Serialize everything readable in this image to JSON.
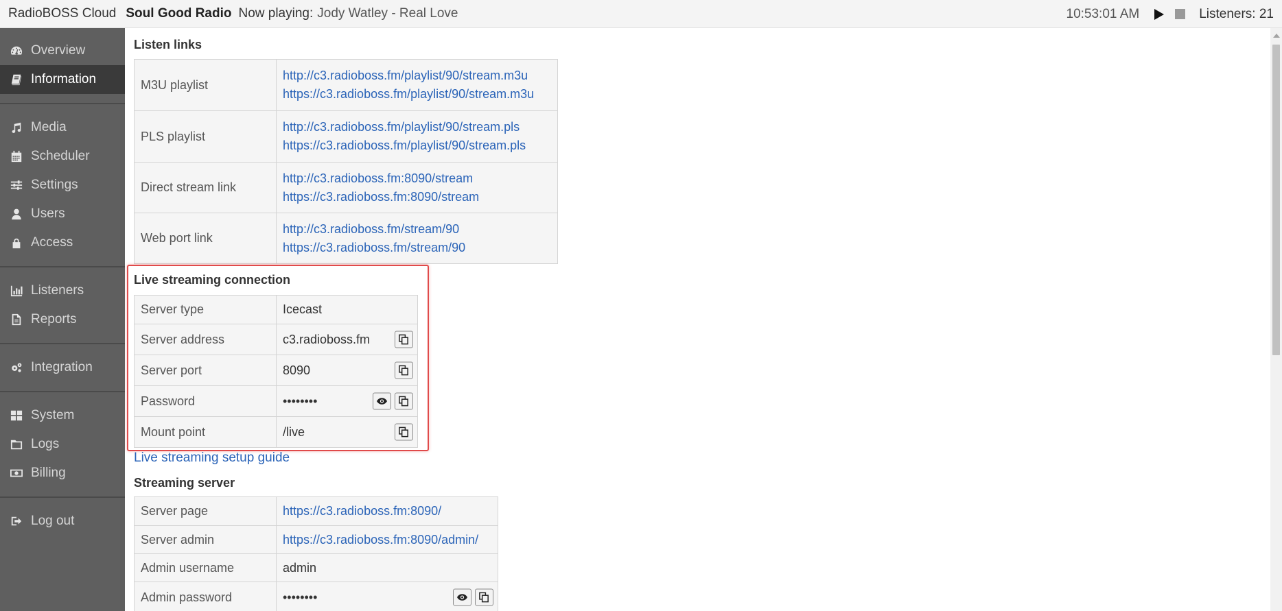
{
  "header": {
    "app_name": "RadioBOSS Cloud",
    "station_name": "Soul Good Radio",
    "now_playing_label": "Now playing:",
    "now_playing_title": "Jody Watley - Real Love",
    "clock": "10:53:01 AM",
    "listeners": "Listeners: 21"
  },
  "sidebar": {
    "items": [
      {
        "label": "Overview",
        "icon": "dashboard-icon"
      },
      {
        "label": "Information",
        "icon": "book-icon",
        "active": true
      },
      {
        "label": "Media",
        "icon": "music-icon"
      },
      {
        "label": "Scheduler",
        "icon": "calendar-icon"
      },
      {
        "label": "Settings",
        "icon": "sliders-icon"
      },
      {
        "label": "Users",
        "icon": "user-icon"
      },
      {
        "label": "Access",
        "icon": "lock-icon"
      },
      {
        "label": "Listeners",
        "icon": "bar-chart-icon"
      },
      {
        "label": "Reports",
        "icon": "document-icon"
      },
      {
        "label": "Integration",
        "icon": "gears-icon"
      },
      {
        "label": "System",
        "icon": "grid-icon"
      },
      {
        "label": "Logs",
        "icon": "folder-icon"
      },
      {
        "label": "Billing",
        "icon": "money-icon"
      },
      {
        "label": "Log out",
        "icon": "sign-out-icon"
      }
    ]
  },
  "listen_links": {
    "title": "Listen links",
    "rows": [
      {
        "label": "M3U playlist",
        "links": [
          "http://c3.radioboss.fm/playlist/90/stream.m3u",
          "https://c3.radioboss.fm/playlist/90/stream.m3u"
        ]
      },
      {
        "label": "PLS playlist",
        "links": [
          "http://c3.radioboss.fm/playlist/90/stream.pls",
          "https://c3.radioboss.fm/playlist/90/stream.pls"
        ]
      },
      {
        "label": "Direct stream link",
        "links": [
          "http://c3.radioboss.fm:8090/stream",
          "https://c3.radioboss.fm:8090/stream"
        ]
      },
      {
        "label": "Web port link",
        "links": [
          "http://c3.radioboss.fm/stream/90",
          "https://c3.radioboss.fm/stream/90"
        ]
      }
    ]
  },
  "live_streaming": {
    "title": "Live streaming connection",
    "rows": [
      {
        "label": "Server type",
        "value": "Icecast"
      },
      {
        "label": "Server address",
        "value": "c3.radioboss.fm"
      },
      {
        "label": "Server port",
        "value": "8090"
      },
      {
        "label": "Password",
        "value": "••••••••"
      },
      {
        "label": "Mount point",
        "value": "/live"
      }
    ],
    "guide_link": "Live streaming setup guide"
  },
  "streaming_server": {
    "title": "Streaming server",
    "rows": [
      {
        "label": "Server page",
        "value": "https://c3.radioboss.fm:8090/"
      },
      {
        "label": "Server admin",
        "value": "https://c3.radioboss.fm:8090/admin/"
      },
      {
        "label": "Admin username",
        "value": "admin"
      },
      {
        "label": "Admin password",
        "value": "••••••••"
      }
    ]
  },
  "colors": {
    "sidebar_bg": "#5f5f5f",
    "sidebar_active": "#3a3a3a",
    "link": "#2b64b8",
    "highlight": "#e04a4a"
  }
}
